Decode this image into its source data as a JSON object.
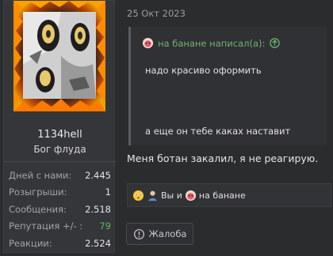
{
  "user": {
    "name": "1134hell",
    "title": "Бог флуда",
    "stats": [
      {
        "label": "Дней с нами:",
        "value": "2.445"
      },
      {
        "label": "Розыгрыши:",
        "value": "1"
      },
      {
        "label": "Сообщения:",
        "value": "2.518"
      },
      {
        "label": "Репутация +/- :",
        "value": "79"
      },
      {
        "label": "Реакции:",
        "value": "2.524"
      }
    ]
  },
  "post": {
    "date": "25 Окт 2023",
    "quote": {
      "author_text": "на банане написал(а):",
      "line1": "надо красиво оформить",
      "line2": "а еще он тебе каках наставит"
    },
    "message": "Меня ботан закалил, я не реагирую.",
    "reactions": {
      "text_you_and": "Вы и",
      "other_user": "на банане"
    },
    "report_label": "Жалоба"
  },
  "colors": {
    "background": "#2b2c2e",
    "card": "#35363a",
    "quote_author": "#6fb36f",
    "reputation_positive": "#5fb85f"
  },
  "icons": [
    "monkey-avatar-icon",
    "arrow-up-circle-icon",
    "emoji-flushed-icon",
    "emoji-person-icon",
    "exclamation-circle-icon"
  ]
}
